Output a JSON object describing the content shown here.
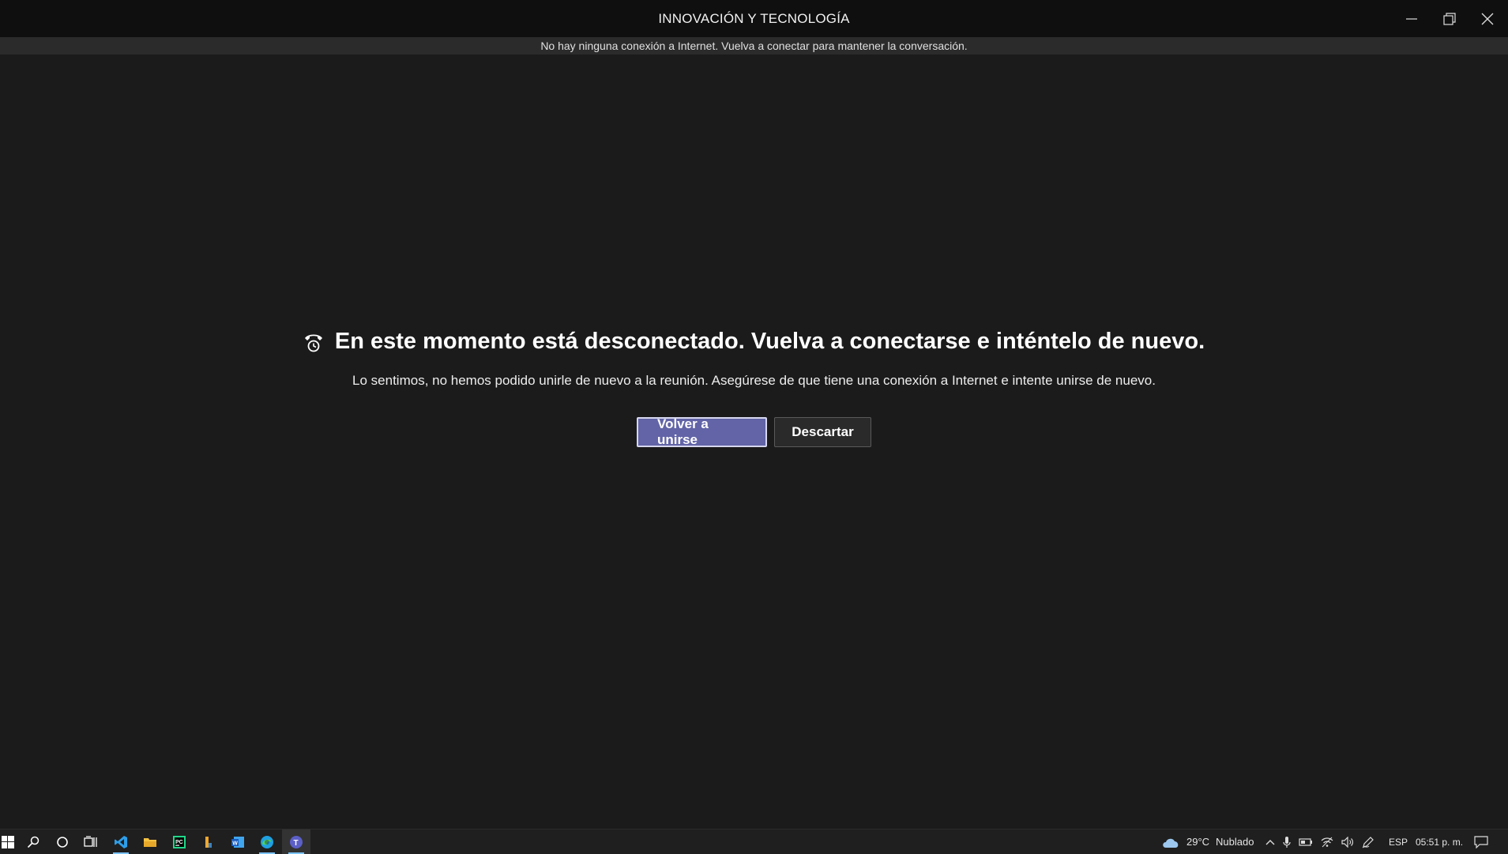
{
  "window": {
    "title": "INNOVACIÓN Y TECNOLOGÍA"
  },
  "notice": {
    "text": "No hay ninguna conexión a Internet. Vuelva a conectar para mantener la conversación."
  },
  "message": {
    "icon": "phone-hangup-clock-icon",
    "headline": "En este momento está desconectado. Vuelva a conectarse e inténtelo de nuevo.",
    "body": "Lo sentimos, no hemos podido unirle de nuevo a la reunión. Asegúrese de que tiene una conexión a Internet e intente unirse de nuevo."
  },
  "actions": {
    "rejoin_label": "Volver a unirse",
    "dismiss_label": "Descartar"
  },
  "taskbar": {
    "apps": [
      "start-icon",
      "search-icon",
      "cortana-icon",
      "task-view-icon",
      "vscode-icon",
      "file-explorer-icon",
      "pycharm-icon",
      "app-icon",
      "word-icon",
      "edge-icon",
      "teams-icon"
    ],
    "weather": {
      "temp": "29°C",
      "condition": "Nublado"
    },
    "language": "ESP",
    "time": "05:51 p. m."
  },
  "colors": {
    "accent": "#6264a7",
    "background": "#1b1b1b",
    "titlebar": "#0f0f0f"
  }
}
